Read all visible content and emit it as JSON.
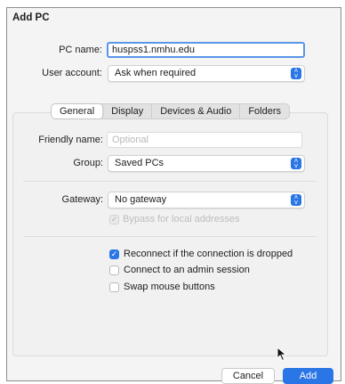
{
  "dialog": {
    "title": "Add PC",
    "pc_name": {
      "label": "PC name:",
      "value": "huspss1.nmhu.edu"
    },
    "user_account": {
      "label": "User account:",
      "value": "Ask when required"
    }
  },
  "tabs": [
    {
      "label": "General",
      "active": true
    },
    {
      "label": "Display",
      "active": false
    },
    {
      "label": "Devices & Audio",
      "active": false
    },
    {
      "label": "Folders",
      "active": false
    }
  ],
  "general": {
    "friendly_name": {
      "label": "Friendly name:",
      "placeholder": "Optional"
    },
    "group": {
      "label": "Group:",
      "value": "Saved PCs"
    },
    "gateway": {
      "label": "Gateway:",
      "value": "No gateway"
    },
    "bypass": {
      "label": "Bypass for local addresses",
      "checked": true,
      "enabled": false
    },
    "reconnect": {
      "label": "Reconnect if the connection is dropped",
      "checked": true
    },
    "admin_session": {
      "label": "Connect to an admin session",
      "checked": false
    },
    "swap_mouse": {
      "label": "Swap mouse buttons",
      "checked": false
    }
  },
  "buttons": {
    "cancel": "Cancel",
    "add": "Add"
  },
  "colors": {
    "accent": "#2b76e6",
    "focus_ring": "#5b95e8"
  },
  "icons": {
    "select_chevron": "chevron-up-down-icon",
    "checkmark": "checkmark-icon",
    "pointer": "mouse-pointer-icon"
  }
}
